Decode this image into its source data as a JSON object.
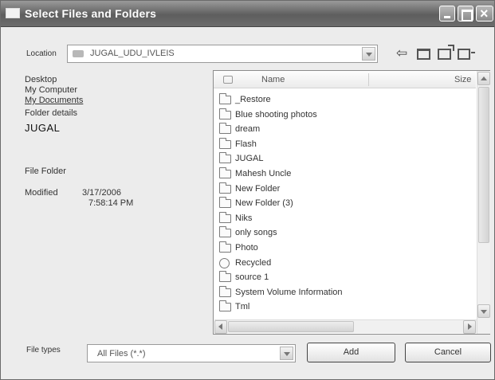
{
  "window": {
    "title": "Select Files and Folders"
  },
  "location": {
    "label": "Location",
    "value": "JUGAL_UDU_IVLEIS"
  },
  "info_panel": {
    "lines": [
      "Desktop",
      "My Computer",
      "My Documents",
      "Folder details",
      "JUGAL",
      "File Folder",
      "Modified",
      "3/17/2006",
      "7:58:14 PM"
    ]
  },
  "file_list": {
    "columns": {
      "name": "Name",
      "size": "Size"
    },
    "items": [
      {
        "name": "_Restore",
        "icon": "folder-icon"
      },
      {
        "name": "Blue shooting photos",
        "icon": "folder-icon"
      },
      {
        "name": "dream",
        "icon": "folder-icon"
      },
      {
        "name": "Flash",
        "icon": "folder-icon"
      },
      {
        "name": "JUGAL",
        "icon": "folder-icon"
      },
      {
        "name": "Mahesh Uncle",
        "icon": "folder-icon"
      },
      {
        "name": "New Folder",
        "icon": "folder-icon"
      },
      {
        "name": "New Folder (3)",
        "icon": "folder-icon"
      },
      {
        "name": "Niks",
        "icon": "folder-icon"
      },
      {
        "name": "only songs",
        "icon": "folder-icon"
      },
      {
        "name": "Photo",
        "icon": "folder-icon"
      },
      {
        "name": "Recycled",
        "icon": "recycle-bin-icon"
      },
      {
        "name": "source 1",
        "icon": "folder-icon"
      },
      {
        "name": "System Volume Information",
        "icon": "folder-icon"
      },
      {
        "name": "Tml",
        "icon": "folder-icon"
      }
    ]
  },
  "file_types": {
    "label": "File types",
    "value": "All Files (*.*)"
  },
  "buttons": {
    "add": "Add",
    "cancel": "Cancel"
  }
}
